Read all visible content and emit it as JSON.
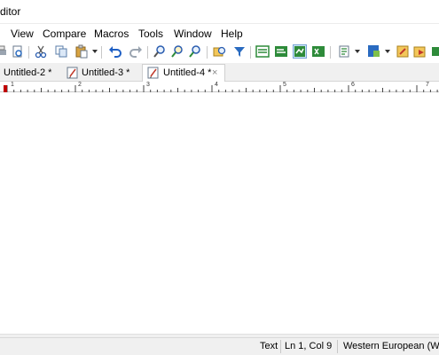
{
  "window": {
    "title": "ditor"
  },
  "menu": [
    "View",
    "Compare",
    "Macros",
    "Tools",
    "Window",
    "Help"
  ],
  "tabs": [
    {
      "label": "Untitled-2 *",
      "active": false
    },
    {
      "label": "Untitled-3 *",
      "active": false
    },
    {
      "label": "Untitled-4 *",
      "active": true,
      "close": "×"
    }
  ],
  "ruler": {
    "labels": [
      "1",
      "2",
      "3",
      "4",
      "5",
      "6",
      "7"
    ]
  },
  "toolbar": {
    "icons": [
      "print-preview-icon",
      "cut-icon",
      "copy-icon",
      "paste-icon",
      "undo-icon",
      "redo-icon",
      "find-icon",
      "find-replace-icon",
      "find-in-files-icon",
      "filter-icon",
      "list-icon",
      "word-wrap-icon",
      "column-mode-icon",
      "hex-view-icon",
      "macro-icon",
      "bookmark-icon",
      "tool-icon",
      "run-icon"
    ]
  },
  "status": {
    "mode": "Text",
    "position": "Ln 1, Col 9",
    "encoding": "Western European (Wir"
  },
  "colors": {
    "accent": "#1e6fd6",
    "ruler_marker": "#c00000",
    "tab_bg": "#f0f0f0"
  }
}
